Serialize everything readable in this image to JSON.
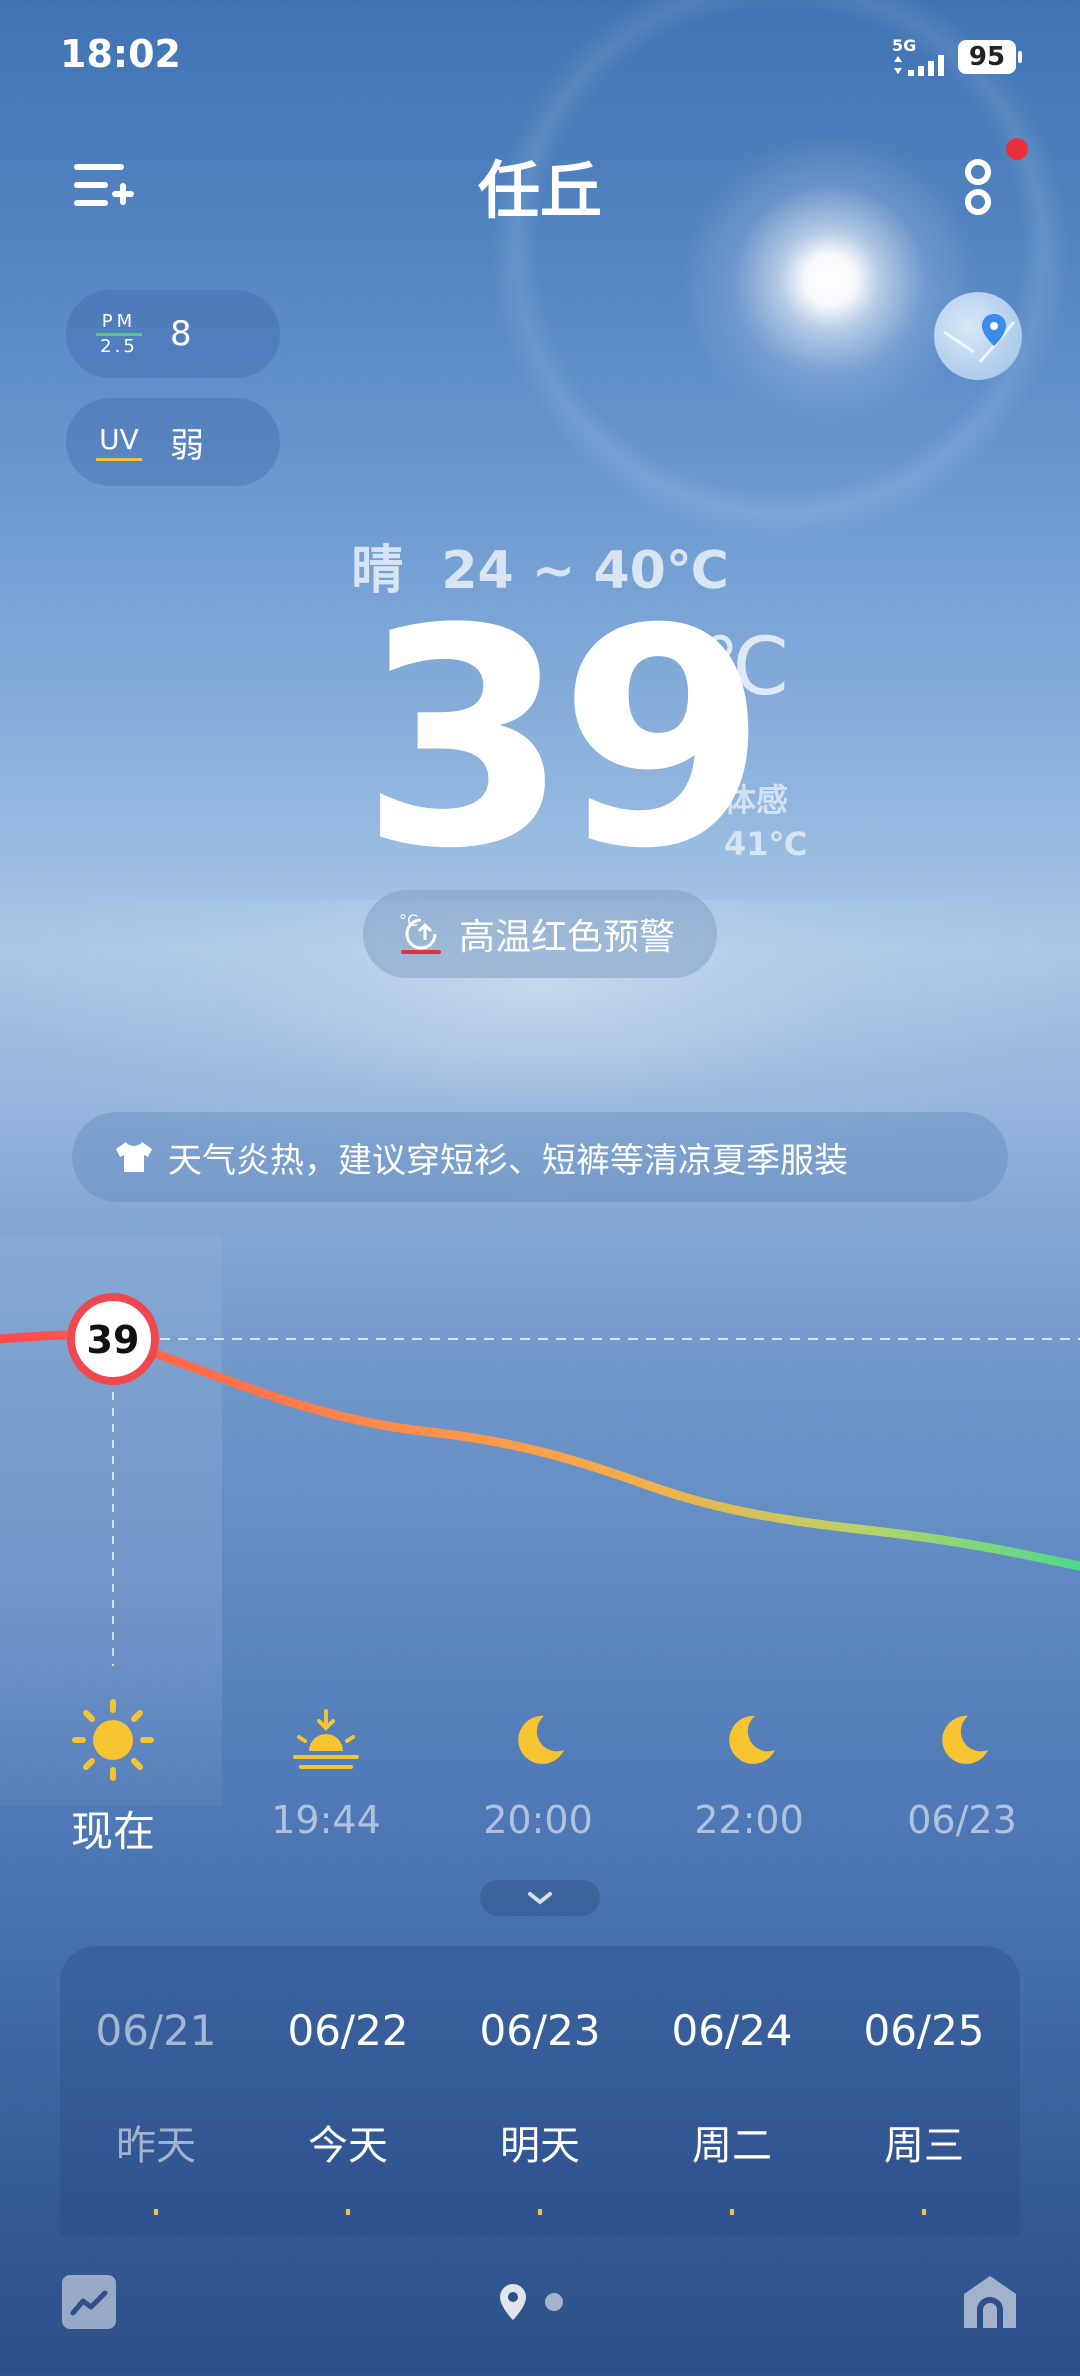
{
  "status_bar": {
    "time": "18:02",
    "network": "5G",
    "battery": "95"
  },
  "header": {
    "city": "任丘"
  },
  "air": {
    "pm_label_top": "PM",
    "pm_label_bottom": "2.5",
    "pm_value": "8",
    "uv_label": "UV",
    "uv_value": "弱"
  },
  "current": {
    "condition": "晴",
    "range": "24 ~ 40℃",
    "temp": "39",
    "unit": "℃",
    "feels_label": "体感",
    "feels_value": "41℃",
    "warning": "高温红色预警",
    "advice": "天气炎热，建议穿短衫、短裤等清凉夏季服装"
  },
  "hourly": {
    "marker_value": "39",
    "items": [
      {
        "label": "现在",
        "icon": "sun-icon"
      },
      {
        "label": "19:44",
        "icon": "sunset-icon"
      },
      {
        "label": "20:00",
        "icon": "moon-icon"
      },
      {
        "label": "22:00",
        "icon": "moon-icon"
      },
      {
        "label": "06/23",
        "icon": "moon-icon"
      }
    ]
  },
  "daily": [
    {
      "date": "06/21",
      "day": "昨天"
    },
    {
      "date": "06/22",
      "day": "今天"
    },
    {
      "date": "06/23",
      "day": "明天"
    },
    {
      "date": "06/24",
      "day": "周二"
    },
    {
      "date": "06/25",
      "day": "周三"
    }
  ],
  "colors": {
    "accent_red": "#e8303b",
    "icon_yellow": "#f5c430",
    "curve_start": "#ff5a4a",
    "curve_mid": "#f4b04a",
    "curve_end": "#55d98a"
  }
}
